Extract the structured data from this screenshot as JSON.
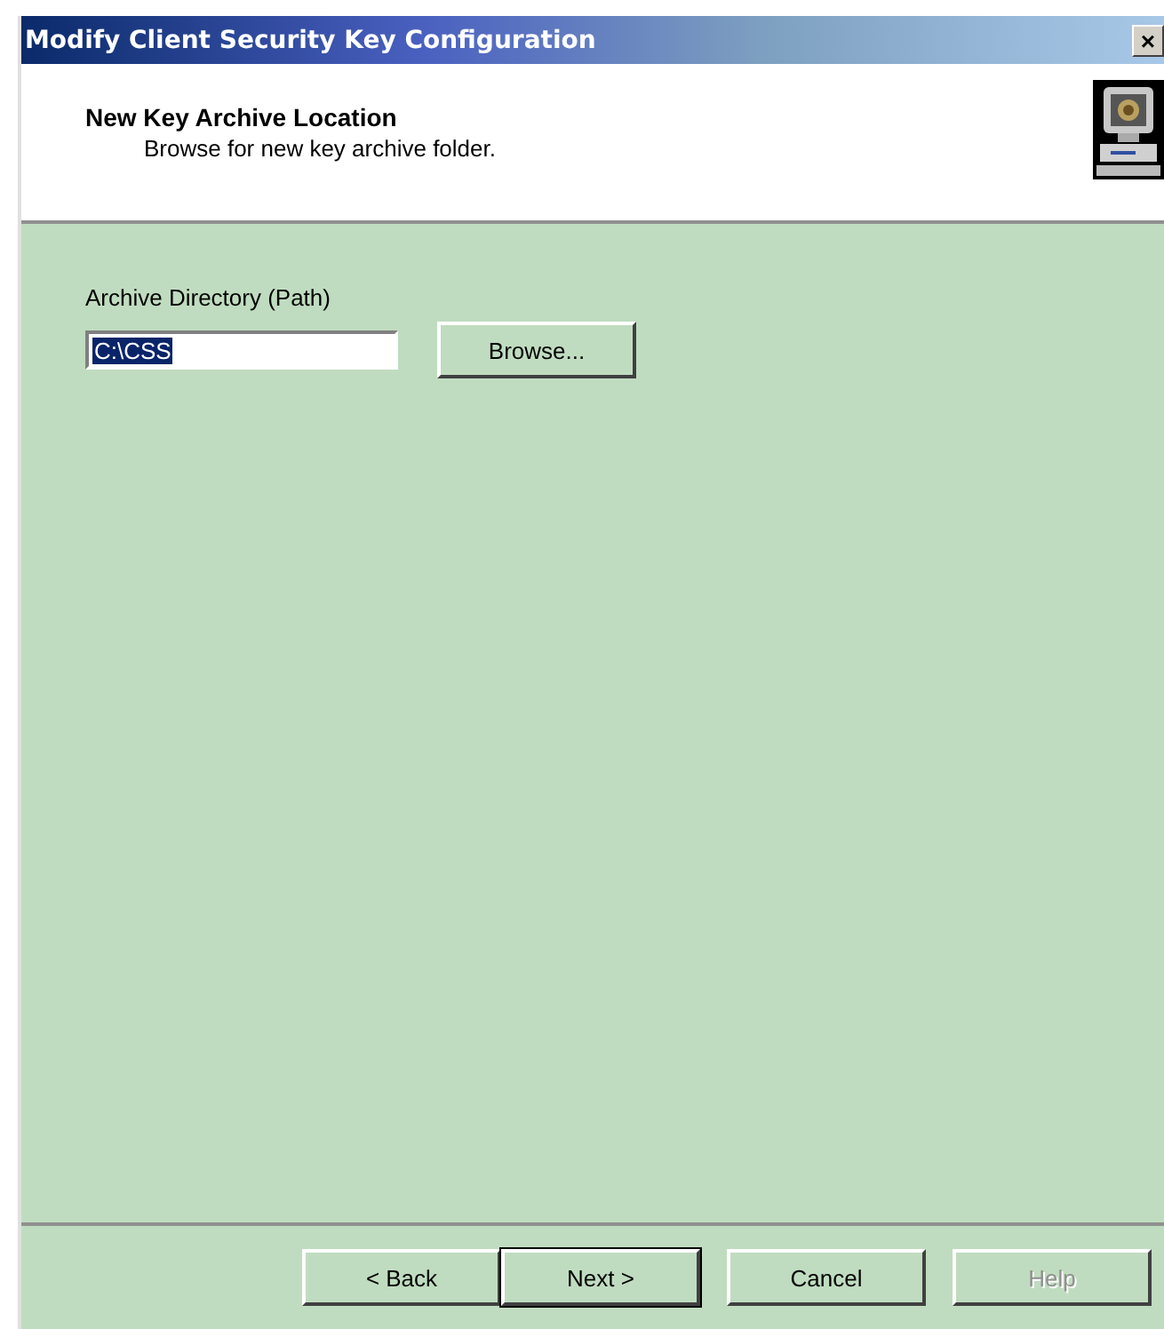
{
  "window": {
    "title": "Modify Client Security Key Configuration",
    "close": "×"
  },
  "header": {
    "title": "New Key Archive Location",
    "subtitle": "Browse for new key archive folder."
  },
  "archive": {
    "label": "Archive Directory (Path)",
    "value": "C:\\CSS",
    "value_selected": true,
    "browse": "Browse..."
  },
  "buttons": [
    {
      "label": "< Back",
      "default": false,
      "disabled": false
    },
    {
      "label": "Next >",
      "default": true,
      "disabled": false
    },
    {
      "label": "Cancel",
      "default": false,
      "disabled": false
    },
    {
      "label": "Help",
      "default": false,
      "disabled": true
    }
  ]
}
